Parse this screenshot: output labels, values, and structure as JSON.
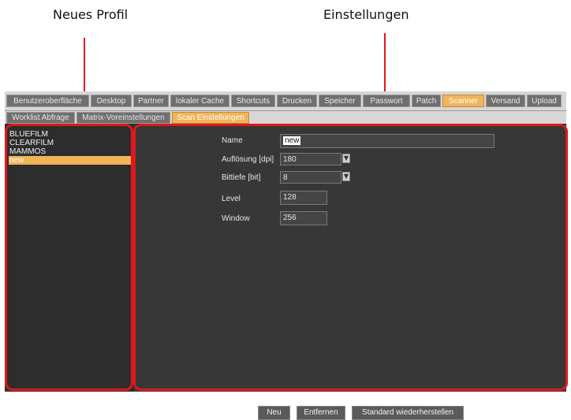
{
  "callouts": {
    "left": "Neues Profil",
    "right": "Einstellungen"
  },
  "tabs": [
    {
      "label": "Benutzeroberfläche",
      "active": false
    },
    {
      "label": "Desktop",
      "active": false
    },
    {
      "label": "Partner",
      "active": false
    },
    {
      "label": "lokaler Cache",
      "active": false
    },
    {
      "label": "Shortcuts",
      "active": false
    },
    {
      "label": "Drucken",
      "active": false
    },
    {
      "label": "Speicher",
      "active": false
    },
    {
      "label": "Passwort",
      "active": false
    },
    {
      "label": "Patch",
      "active": false
    },
    {
      "label": "Scanner",
      "active": true
    },
    {
      "label": "Versand",
      "active": false
    },
    {
      "label": "Upload",
      "active": false
    }
  ],
  "subtabs": [
    {
      "label": "Worklist Abfrage",
      "active": false
    },
    {
      "label": "Matrix-Voreinstellungen",
      "active": false
    },
    {
      "label": "Scan Einstellungen",
      "active": true
    }
  ],
  "profiles": [
    {
      "label": "BLUEFILM",
      "selected": false
    },
    {
      "label": "CLEARFILM",
      "selected": false
    },
    {
      "label": "MAMMOS",
      "selected": false
    },
    {
      "label": "new",
      "selected": true
    }
  ],
  "form": {
    "name_label": "Name",
    "name_value": "new",
    "resolution_label": "Auflösung [dpi]",
    "resolution_value": "180",
    "bitdepth_label": "Bittiefe [bit]",
    "bitdepth_value": "8",
    "level_label": "Level",
    "level_value": "128",
    "window_label": "Window",
    "window_value": "256"
  },
  "buttons": {
    "new": "Neu",
    "remove": "Entfernen",
    "restore": "Standard wiederherstellen"
  },
  "colors": {
    "accent": "#f0b45a",
    "callout_red": "#e0171b"
  },
  "icons": {
    "dropdown": "chevron-down-icon"
  }
}
